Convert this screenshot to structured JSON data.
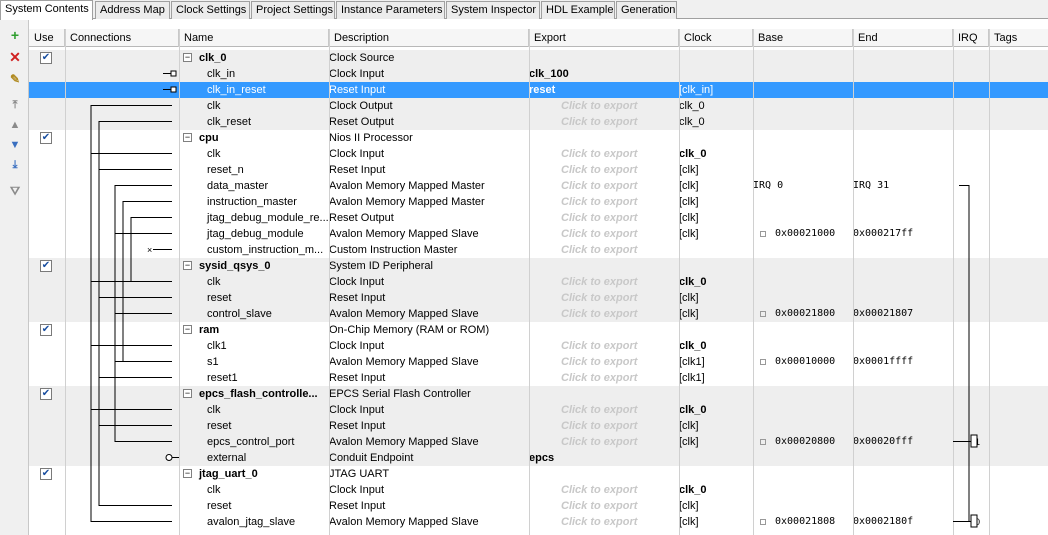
{
  "tabs": [
    "System Contents",
    "Address Map",
    "Clock Settings",
    "Project Settings",
    "Instance Parameters",
    "System Inspector",
    "HDL Example",
    "Generation"
  ],
  "toolbar": {
    "add_icon": "plus-icon",
    "remove_icon": "x-icon",
    "edit_icon": "edit-icon",
    "move_top_icon": "move-top-icon",
    "move_up_icon": "move-up-icon",
    "move_down_icon": "move-down-icon",
    "move_bottom_icon": "move-bottom-icon",
    "filter_icon": "filter-icon"
  },
  "columns": {
    "use": "Use",
    "connections": "Connections",
    "name": "Name",
    "description": "Description",
    "export": "Export",
    "clock": "Clock",
    "base": "Base",
    "end": "End",
    "irq": "IRQ",
    "tags": "Tags"
  },
  "colors": {
    "selection": "#3399ff",
    "group_bg": "#eeeeee"
  },
  "rows": [
    {
      "type": "comp",
      "name": "clk_0",
      "desc": "Clock Source",
      "export": "",
      "clock": "",
      "base": "",
      "end": "",
      "irq": ""
    },
    {
      "type": "sub",
      "name": "clk_in",
      "desc": "Clock Input",
      "export": "clk_100",
      "clock": "",
      "base": "",
      "end": "",
      "irq": ""
    },
    {
      "type": "sub",
      "name": "clk_in_reset",
      "desc": "Reset Input",
      "export": "reset",
      "clock": "[clk_in]",
      "base": "",
      "end": "",
      "irq": "",
      "selected": true
    },
    {
      "type": "sub",
      "name": "clk",
      "desc": "Clock Output",
      "export": "Click to export",
      "clock": "clk_0",
      "base": "",
      "end": "",
      "irq": ""
    },
    {
      "type": "sub",
      "name": "clk_reset",
      "desc": "Reset Output",
      "export": "Click to export",
      "clock": "clk_0",
      "base": "",
      "end": "",
      "irq": ""
    },
    {
      "type": "comp",
      "name": "cpu",
      "desc": "Nios II Processor",
      "export": "",
      "clock": "",
      "base": "",
      "end": "",
      "irq": ""
    },
    {
      "type": "sub",
      "name": "clk",
      "desc": "Clock Input",
      "export": "Click to export",
      "clock": "clk_0",
      "clock_bold": true,
      "base": "",
      "end": "",
      "irq": ""
    },
    {
      "type": "sub",
      "name": "reset_n",
      "desc": "Reset Input",
      "export": "Click to export",
      "clock": "[clk]",
      "base": "",
      "end": "",
      "irq": ""
    },
    {
      "type": "sub",
      "name": "data_master",
      "desc": "Avalon Memory Mapped Master",
      "export": "Click to export",
      "clock": "[clk]",
      "base": "IRQ 0",
      "end": "IRQ 31",
      "irq": ""
    },
    {
      "type": "sub",
      "name": "instruction_master",
      "desc": "Avalon Memory Mapped Master",
      "export": "Click to export",
      "clock": "[clk]",
      "base": "",
      "end": "",
      "irq": ""
    },
    {
      "type": "sub",
      "name": "jtag_debug_module_re...",
      "desc": "Reset Output",
      "export": "Click to export",
      "clock": "[clk]",
      "base": "",
      "end": "",
      "irq": ""
    },
    {
      "type": "sub",
      "name": "jtag_debug_module",
      "desc": "Avalon Memory Mapped Slave",
      "export": "Click to export",
      "clock": "[clk]",
      "base": "0x00021000",
      "end": "0x000217ff",
      "irq": "",
      "lock": true
    },
    {
      "type": "sub",
      "name": "custom_instruction_m...",
      "desc": "Custom Instruction Master",
      "export": "Click to export",
      "clock": "",
      "base": "",
      "end": "",
      "irq": ""
    },
    {
      "type": "comp",
      "name": "sysid_qsys_0",
      "desc": "System ID Peripheral",
      "export": "",
      "clock": "",
      "base": "",
      "end": "",
      "irq": ""
    },
    {
      "type": "sub",
      "name": "clk",
      "desc": "Clock Input",
      "export": "Click to export",
      "clock": "clk_0",
      "clock_bold": true,
      "base": "",
      "end": "",
      "irq": ""
    },
    {
      "type": "sub",
      "name": "reset",
      "desc": "Reset Input",
      "export": "Click to export",
      "clock": "[clk]",
      "base": "",
      "end": "",
      "irq": ""
    },
    {
      "type": "sub",
      "name": "control_slave",
      "desc": "Avalon Memory Mapped Slave",
      "export": "Click to export",
      "clock": "[clk]",
      "base": "0x00021800",
      "end": "0x00021807",
      "irq": "",
      "lock": true
    },
    {
      "type": "comp",
      "name": "ram",
      "desc": "On-Chip Memory (RAM or ROM)",
      "export": "",
      "clock": "",
      "base": "",
      "end": "",
      "irq": ""
    },
    {
      "type": "sub",
      "name": "clk1",
      "desc": "Clock Input",
      "export": "Click to export",
      "clock": "clk_0",
      "clock_bold": true,
      "base": "",
      "end": "",
      "irq": ""
    },
    {
      "type": "sub",
      "name": "s1",
      "desc": "Avalon Memory Mapped Slave",
      "export": "Click to export",
      "clock": "[clk1]",
      "base": "0x00010000",
      "end": "0x0001ffff",
      "irq": "",
      "lock": true
    },
    {
      "type": "sub",
      "name": "reset1",
      "desc": "Reset Input",
      "export": "Click to export",
      "clock": "[clk1]",
      "base": "",
      "end": "",
      "irq": ""
    },
    {
      "type": "comp",
      "name": "epcs_flash_controlle...",
      "desc": "EPCS Serial Flash Controller",
      "export": "",
      "clock": "",
      "base": "",
      "end": "",
      "irq": ""
    },
    {
      "type": "sub",
      "name": "clk",
      "desc": "Clock Input",
      "export": "Click to export",
      "clock": "clk_0",
      "clock_bold": true,
      "base": "",
      "end": "",
      "irq": ""
    },
    {
      "type": "sub",
      "name": "reset",
      "desc": "Reset Input",
      "export": "Click to export",
      "clock": "[clk]",
      "base": "",
      "end": "",
      "irq": ""
    },
    {
      "type": "sub",
      "name": "epcs_control_port",
      "desc": "Avalon Memory Mapped Slave",
      "export": "Click to export",
      "clock": "[clk]",
      "base": "0x00020800",
      "end": "0x00020fff",
      "irq": "1",
      "lock": true
    },
    {
      "type": "sub",
      "name": "external",
      "desc": "Conduit Endpoint",
      "export": "epcs",
      "clock": "",
      "base": "",
      "end": "",
      "irq": ""
    },
    {
      "type": "comp",
      "name": "jtag_uart_0",
      "desc": "JTAG UART",
      "export": "",
      "clock": "",
      "base": "",
      "end": "",
      "irq": ""
    },
    {
      "type": "sub",
      "name": "clk",
      "desc": "Clock Input",
      "export": "Click to export",
      "clock": "clk_0",
      "clock_bold": true,
      "base": "",
      "end": "",
      "irq": ""
    },
    {
      "type": "sub",
      "name": "reset",
      "desc": "Reset Input",
      "export": "Click to export",
      "clock": "[clk]",
      "base": "",
      "end": "",
      "irq": ""
    },
    {
      "type": "sub",
      "name": "avalon_jtag_slave",
      "desc": "Avalon Memory Mapped Slave",
      "export": "Click to export",
      "clock": "[clk]",
      "base": "0x00021808",
      "end": "0x0002180f",
      "irq": "0",
      "lock": true
    }
  ]
}
